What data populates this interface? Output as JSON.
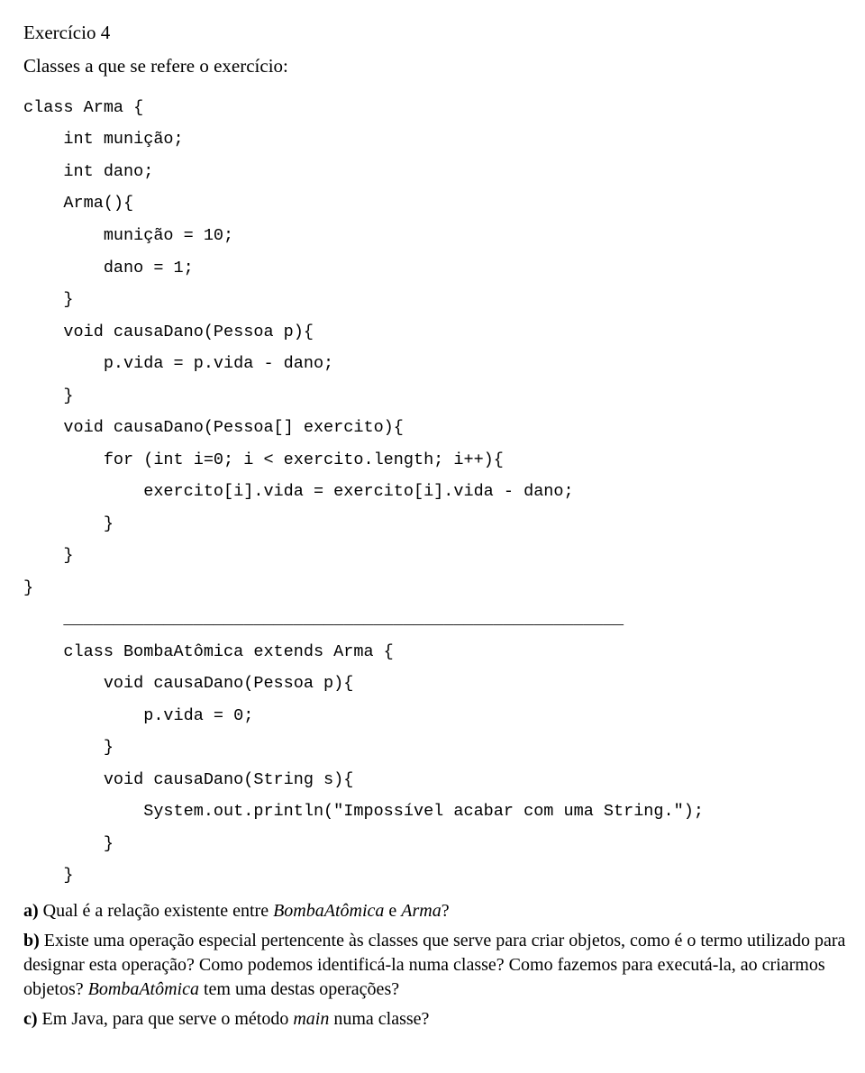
{
  "title": "Exercício 4",
  "subtitle": "Classes a que se refere o exercício:",
  "code": "class Arma {\n    int munição;\n    int dano;\n    Arma(){\n        munição = 10;\n        dano = 1;\n    }\n    void causaDano(Pessoa p){\n        p.vida = p.vida - dano;\n    }\n    void causaDano(Pessoa[] exercito){\n        for (int i=0; i < exercito.length; i++){\n            exercito[i].vida = exercito[i].vida - dano;\n        }\n    }\n}\n    ________________________________________________________\n    class BombaAtômica extends Arma {\n        void causaDano(Pessoa p){\n            p.vida = 0;\n        }\n        void causaDano(String s){\n            System.out.println(\"Impossível acabar com uma String.\");\n        }\n    }",
  "qa": {
    "label": "a) ",
    "text1": "Qual é a relação existente entre ",
    "i1": "BombaAtômica",
    "text2": " e ",
    "i2": "Arma",
    "text3": "?"
  },
  "qb": {
    "label": "b) ",
    "text1": "Existe uma operação especial pertencente às classes que serve para criar objetos, como é o termo utilizado para designar esta operação?  Como podemos identificá-la numa classe? Como fazemos para executá-la, ao criarmos objetos?  ",
    "i1": "BombaAtômica",
    "text2": " tem uma destas operações?"
  },
  "qc": {
    "label": "c) ",
    "text1": "Em Java, para que serve o método ",
    "i1": "main",
    "text2": " numa classe?"
  }
}
